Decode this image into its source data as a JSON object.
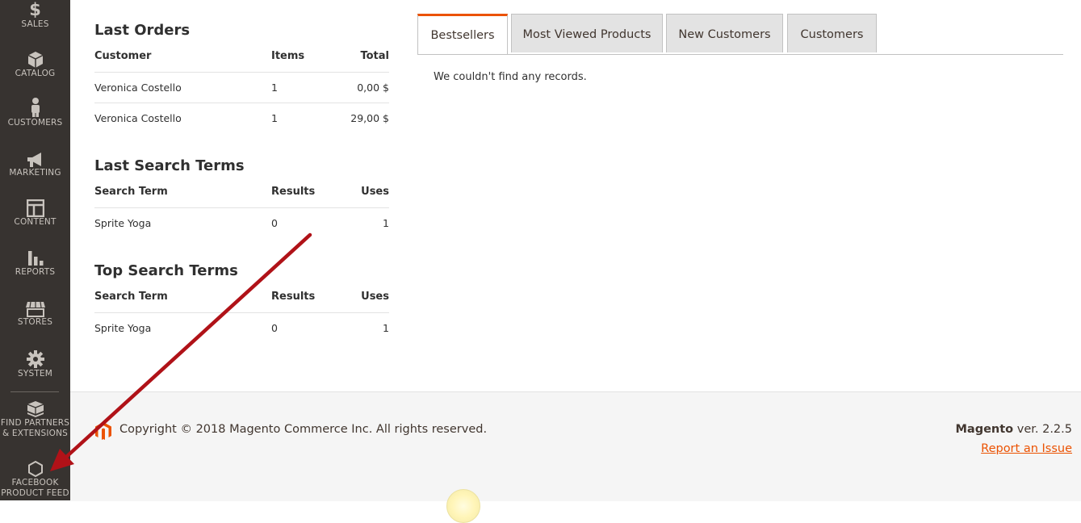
{
  "sidebar": {
    "items": [
      {
        "label": "SALES",
        "icon": "dollar-icon"
      },
      {
        "label": "CATALOG",
        "icon": "cube-icon"
      },
      {
        "label": "CUSTOMERS",
        "icon": "person-icon"
      },
      {
        "label": "MARKETING",
        "icon": "megaphone-icon"
      },
      {
        "label": "CONTENT",
        "icon": "layout-icon"
      },
      {
        "label": "REPORTS",
        "icon": "bar-chart-icon"
      },
      {
        "label": "STORES",
        "icon": "storefront-icon"
      },
      {
        "label": "SYSTEM",
        "icon": "gear-icon"
      },
      {
        "label1": "FIND PARTNERS",
        "label2": "& EXTENSIONS",
        "icon": "boxes-icon"
      },
      {
        "label1": "FACEBOOK",
        "label2": "PRODUCT FEED",
        "icon": "hexagon-icon"
      }
    ]
  },
  "last_orders": {
    "title": "Last Orders",
    "headers": [
      "Customer",
      "Items",
      "Total"
    ],
    "rows": [
      [
        "Veronica Costello",
        "1",
        "0,00 $"
      ],
      [
        "Veronica Costello",
        "1",
        "29,00 $"
      ]
    ]
  },
  "last_search": {
    "title": "Last Search Terms",
    "headers": [
      "Search Term",
      "Results",
      "Uses"
    ],
    "rows": [
      [
        "Sprite Yoga",
        "0",
        "1"
      ]
    ]
  },
  "top_search": {
    "title": "Top Search Terms",
    "headers": [
      "Search Term",
      "Results",
      "Uses"
    ],
    "rows": [
      [
        "Sprite Yoga",
        "0",
        "1"
      ]
    ]
  },
  "tabs": [
    {
      "label": "Bestsellers",
      "active": true
    },
    {
      "label": "Most Viewed Products",
      "active": false
    },
    {
      "label": "New Customers",
      "active": false
    },
    {
      "label": "Customers",
      "active": false
    }
  ],
  "tab_content": {
    "empty_message": "We couldn't find any records."
  },
  "footer": {
    "copyright": "Copyright © 2018 Magento Commerce Inc. All rights reserved.",
    "brand": "Magento",
    "version": " ver. 2.2.5",
    "report_link": "Report an Issue"
  },
  "colors": {
    "accent": "#eb5202",
    "sidebar_bg": "#373330",
    "arrow": "#b01218"
  }
}
